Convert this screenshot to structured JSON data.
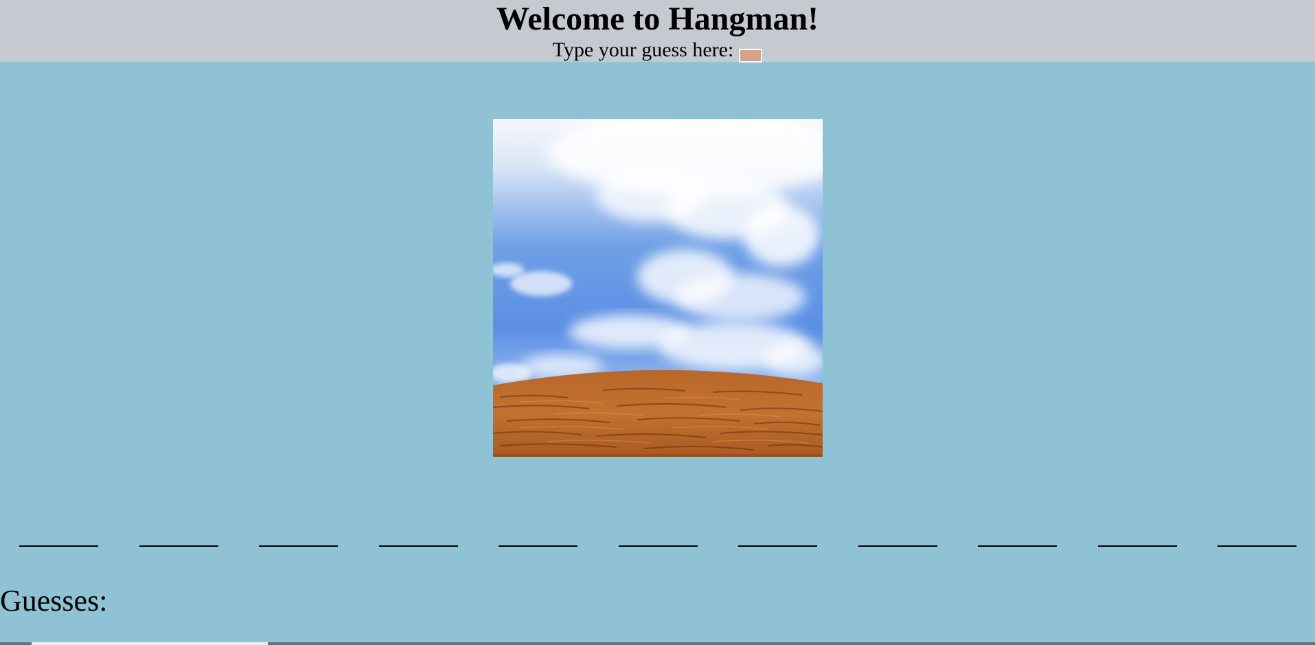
{
  "header": {
    "title": "Welcome to Hangman!",
    "guess_prompt": "Type your guess here:",
    "guess_input_value": ""
  },
  "scene": {
    "image": "hangman-scene-sky-and-wooden-ground"
  },
  "word": {
    "letters": [
      "",
      "",
      "",
      "",
      "",
      "",
      "",
      "",
      "",
      "",
      ""
    ]
  },
  "guesses": {
    "label": "Guesses:",
    "letters": ""
  },
  "colors": {
    "page_background": "#8fc2d4",
    "header_background": "#c4cad0",
    "input_background": "#d8a08e"
  }
}
